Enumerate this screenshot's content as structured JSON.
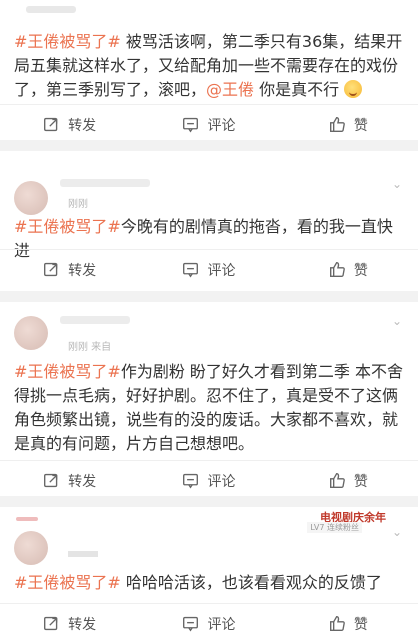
{
  "posts": [
    {
      "tag": "#王倦被骂了#",
      "text": " 被骂活该啊，第二季只有36集，结果开局五集就这样水了，又给配角加一些不需要存在的戏份了，第三季别写了，滚吧，",
      "mention": "@王倦",
      "text_after": " 你是真不行",
      "emoji_name": "drooling-face-emoji"
    },
    {
      "meta": "刚刚",
      "tag": "#王倦被骂了#",
      "text": "今晚有的剧情真的拖沓，看的我一直快进"
    },
    {
      "meta": "刚刚  来自",
      "tag": "#王倦被骂了#",
      "text": "作为剧粉 盼了好久才看到第二季 本不舍得挑一点毛病，好好护剧。忍不住了，真是受不了这俩角色频繁出镜，说些有的没的废话。大家都不喜欢，就是真的有问题，片方自己想想吧。"
    },
    {
      "badge": "电视剧庆余年",
      "badge_level": "LV7 连续粉丝",
      "tag": "#王倦被骂了#",
      "text": " 哈哈哈活该，也该看看观众的反馈了"
    }
  ],
  "actions": {
    "repost": "转发",
    "comment": "评论",
    "like": "赞"
  },
  "colors": {
    "accent": "#eb7350",
    "background": "#f2f2f2"
  }
}
